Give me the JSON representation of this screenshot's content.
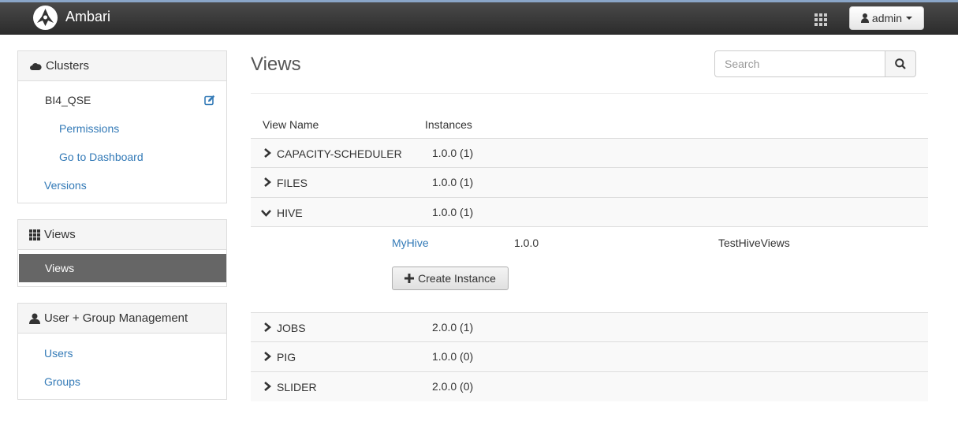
{
  "app": {
    "name": "Ambari"
  },
  "navbar": {
    "user_label": "admin",
    "icons": [
      "ambari-logo-icon",
      "apps-grid-icon",
      "user-icon",
      "caret-down-icon"
    ]
  },
  "sidebar": {
    "clusters": {
      "title": "Clusters",
      "cluster_name": "BI4_QSE",
      "links": [
        "Permissions",
        "Go to Dashboard"
      ],
      "versions_link": "Versions"
    },
    "views": {
      "title": "Views",
      "active_item": "Views"
    },
    "user_mgmt": {
      "title": "User + Group Management",
      "links": [
        "Users",
        "Groups"
      ]
    }
  },
  "main": {
    "title": "Views",
    "search_placeholder": "Search",
    "columns": [
      "View Name",
      "Instances"
    ],
    "views": [
      {
        "name": "CAPACITY-SCHEDULER",
        "version": "1.0.0 (1)",
        "expanded": false
      },
      {
        "name": "FILES",
        "version": "1.0.0 (1)",
        "expanded": false
      },
      {
        "name": "HIVE",
        "version": "1.0.0 (1)",
        "expanded": true
      },
      {
        "name": "JOBS",
        "version": "2.0.0 (1)",
        "expanded": false
      },
      {
        "name": "PIG",
        "version": "1.0.0 (0)",
        "expanded": false
      },
      {
        "name": "SLIDER",
        "version": "2.0.0 (0)",
        "expanded": false
      }
    ],
    "hive_instance": {
      "name": "MyHive",
      "version": "1.0.0",
      "label": "TestHiveViews"
    },
    "create_instance_label": "Create Instance"
  },
  "colors": {
    "link": "#337ab7",
    "navbar": "#333333",
    "active": "#666666"
  }
}
